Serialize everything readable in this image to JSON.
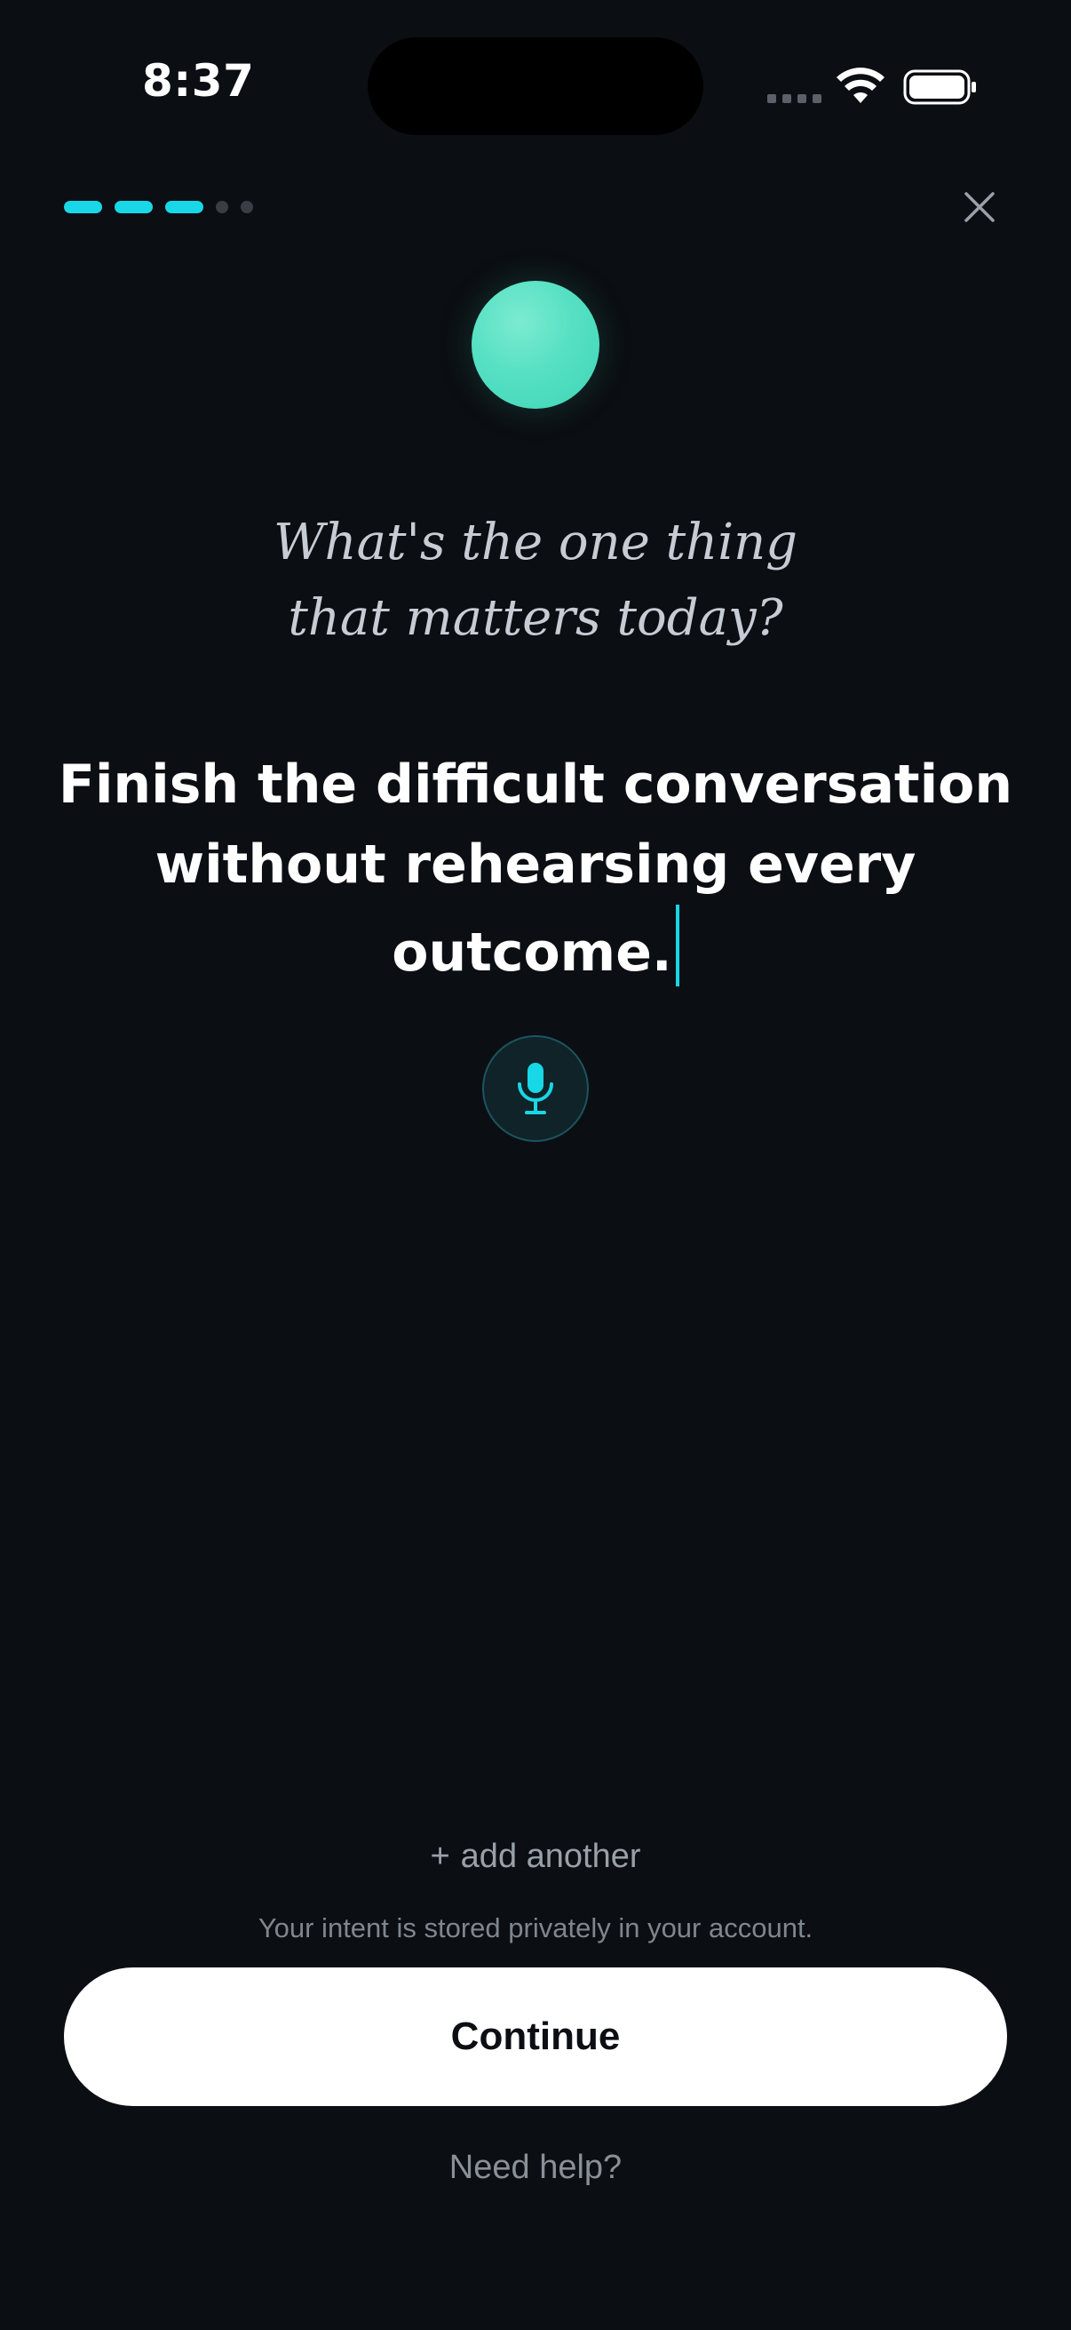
{
  "status_bar": {
    "time": "8:37",
    "icons": [
      "signal-icon",
      "wifi-icon",
      "battery-icon"
    ]
  },
  "progress": {
    "steps_total": 5,
    "steps_completed": 3
  },
  "prompt": {
    "line1": "What's the one thing",
    "line2": "that matters today?"
  },
  "answer": {
    "text": "Finish the difficult conversation without rehearsing every outcome."
  },
  "mic": {
    "icon": "microphone-icon"
  },
  "add_another": {
    "plus": "+",
    "label": "add another"
  },
  "privacy_note": "Your intent is stored privately in your account.",
  "continue_label": "Continue",
  "help_label": "Need help?",
  "colors": {
    "background": "#0b0e13",
    "accent": "#18d7e6",
    "orb": "#4fdcc0"
  }
}
